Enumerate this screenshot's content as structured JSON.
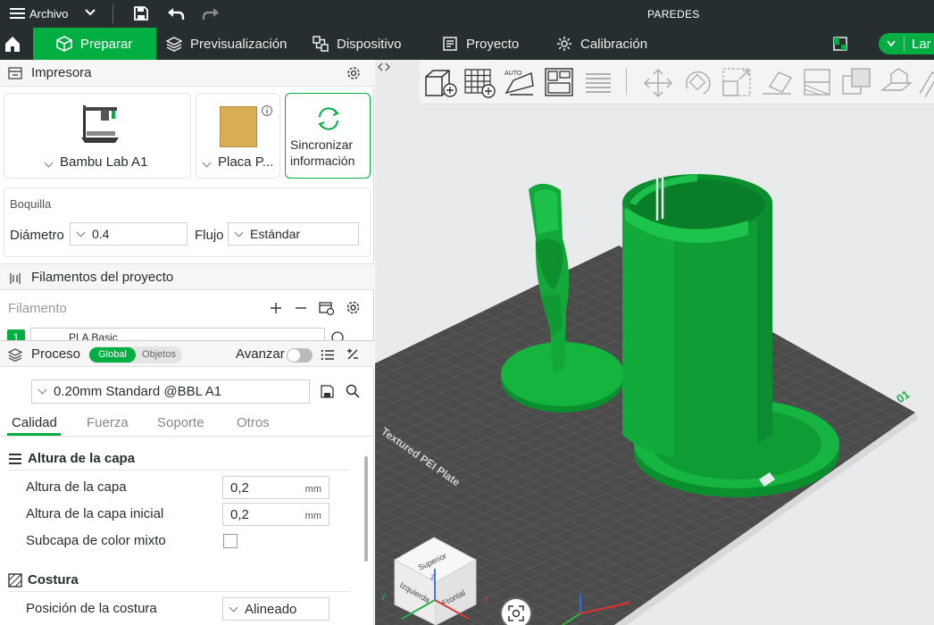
{
  "titlebar": {
    "menu_label": "Archivo",
    "title": "PAREDES"
  },
  "nav": {
    "tabs": [
      {
        "label": "Preparar"
      },
      {
        "label": "Previsualización"
      },
      {
        "label": "Dispositivo"
      },
      {
        "label": "Proyecto"
      },
      {
        "label": "Calibración"
      }
    ],
    "slice_partial": "Lar"
  },
  "printer": {
    "section_title": "Impresora",
    "printer_name": "Bambu Lab A1",
    "plate_name": "Placa P...",
    "sync_line1": "Sincronizar",
    "sync_line2": "información"
  },
  "nozzle": {
    "title": "Boquilla",
    "diameter_label": "Diámetro",
    "diameter_value": "0.4",
    "flow_label": "Flujo",
    "flow_value": "Estándar"
  },
  "filaments": {
    "section_title": "Filamentos del proyecto",
    "filament_label": "Filamento",
    "items": [
      {
        "index": "1",
        "name": "PLA Basic"
      }
    ]
  },
  "process": {
    "section_title": "Proceso",
    "toggle_global": "Global",
    "toggle_objects": "Objetos",
    "advance_label": "Avanzar",
    "preset": "0.20mm Standard @BBL A1",
    "tabs": [
      "Calidad",
      "Fuerza",
      "Soporte",
      "Otros"
    ]
  },
  "quality": {
    "layer_group": "Altura de la capa",
    "layer_height_label": "Altura de la capa",
    "layer_height_value": "0,2",
    "first_layer_label": "Altura de la capa inicial",
    "first_layer_value": "0,2",
    "unit": "mm",
    "mixed_label": "Subcapa de color mixto",
    "seam_group": "Costura",
    "seam_pos_label": "Posición de la costura",
    "seam_pos_value": "Alineado"
  },
  "viewport": {
    "plate_text": "Textured PEI Plate",
    "plate_number": "01",
    "cube_top": "Superior",
    "cube_left": "Izquierda",
    "cube_front": "Frontal",
    "axis_x": "x",
    "axis_y": "y",
    "axis_z": "z"
  },
  "colors": {
    "accent": "#00ae42",
    "dark": "#262e30",
    "model": "#11a83a"
  }
}
